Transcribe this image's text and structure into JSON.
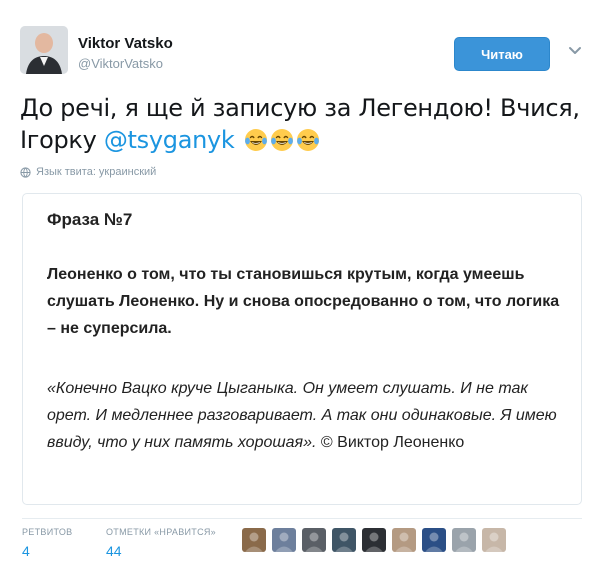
{
  "author": {
    "name": "Viktor Vatsko",
    "handle": "@ViktorVatsko"
  },
  "follow_button": {
    "label": "Читаю"
  },
  "tweet": {
    "text_before": "До речі, я ще й записую за Легендою! Вчися, Ігорку ",
    "mention": "@tsyganyk",
    "emoji_count": 3,
    "emoji_icon": "face-with-tears-of-joy-icon"
  },
  "language_note": "Язык твита: украинский",
  "card": {
    "title": "Фраза №7",
    "bold_text": "Леоненко о том, что ты становишься крутым, когда умеешь слушать Леоненко. Ну и снова опосредованно о том, что логика – не суперсила.",
    "quote_text": "«Конечно Вацко круче Цыганыка. Он умеет слушать. И не так орет. И медленнее разговаривает. А так они одинаковые. Я имею ввиду, что у них память хорошая».",
    "quote_attribution": "© Виктор Леоненко"
  },
  "stats": {
    "retweets_label": "РЕТВИТОВ",
    "retweets_value": "4",
    "likes_label": "ОТМЕТКИ «НРАВИТСЯ»",
    "likes_value": "44"
  },
  "liker_avatars": [
    {
      "color": "#8a6a4a"
    },
    {
      "color": "#6d7f9c"
    },
    {
      "color": "#5a5f66"
    },
    {
      "color": "#3f5566"
    },
    {
      "color": "#2c2f34"
    },
    {
      "color": "#b49a82"
    },
    {
      "color": "#2b4f86"
    },
    {
      "color": "#9aa3ab"
    },
    {
      "color": "#c7b7a8"
    }
  ],
  "colors": {
    "accent": "#1b95e0",
    "follow_button": "#3b94d9",
    "muted": "#8899a6"
  }
}
